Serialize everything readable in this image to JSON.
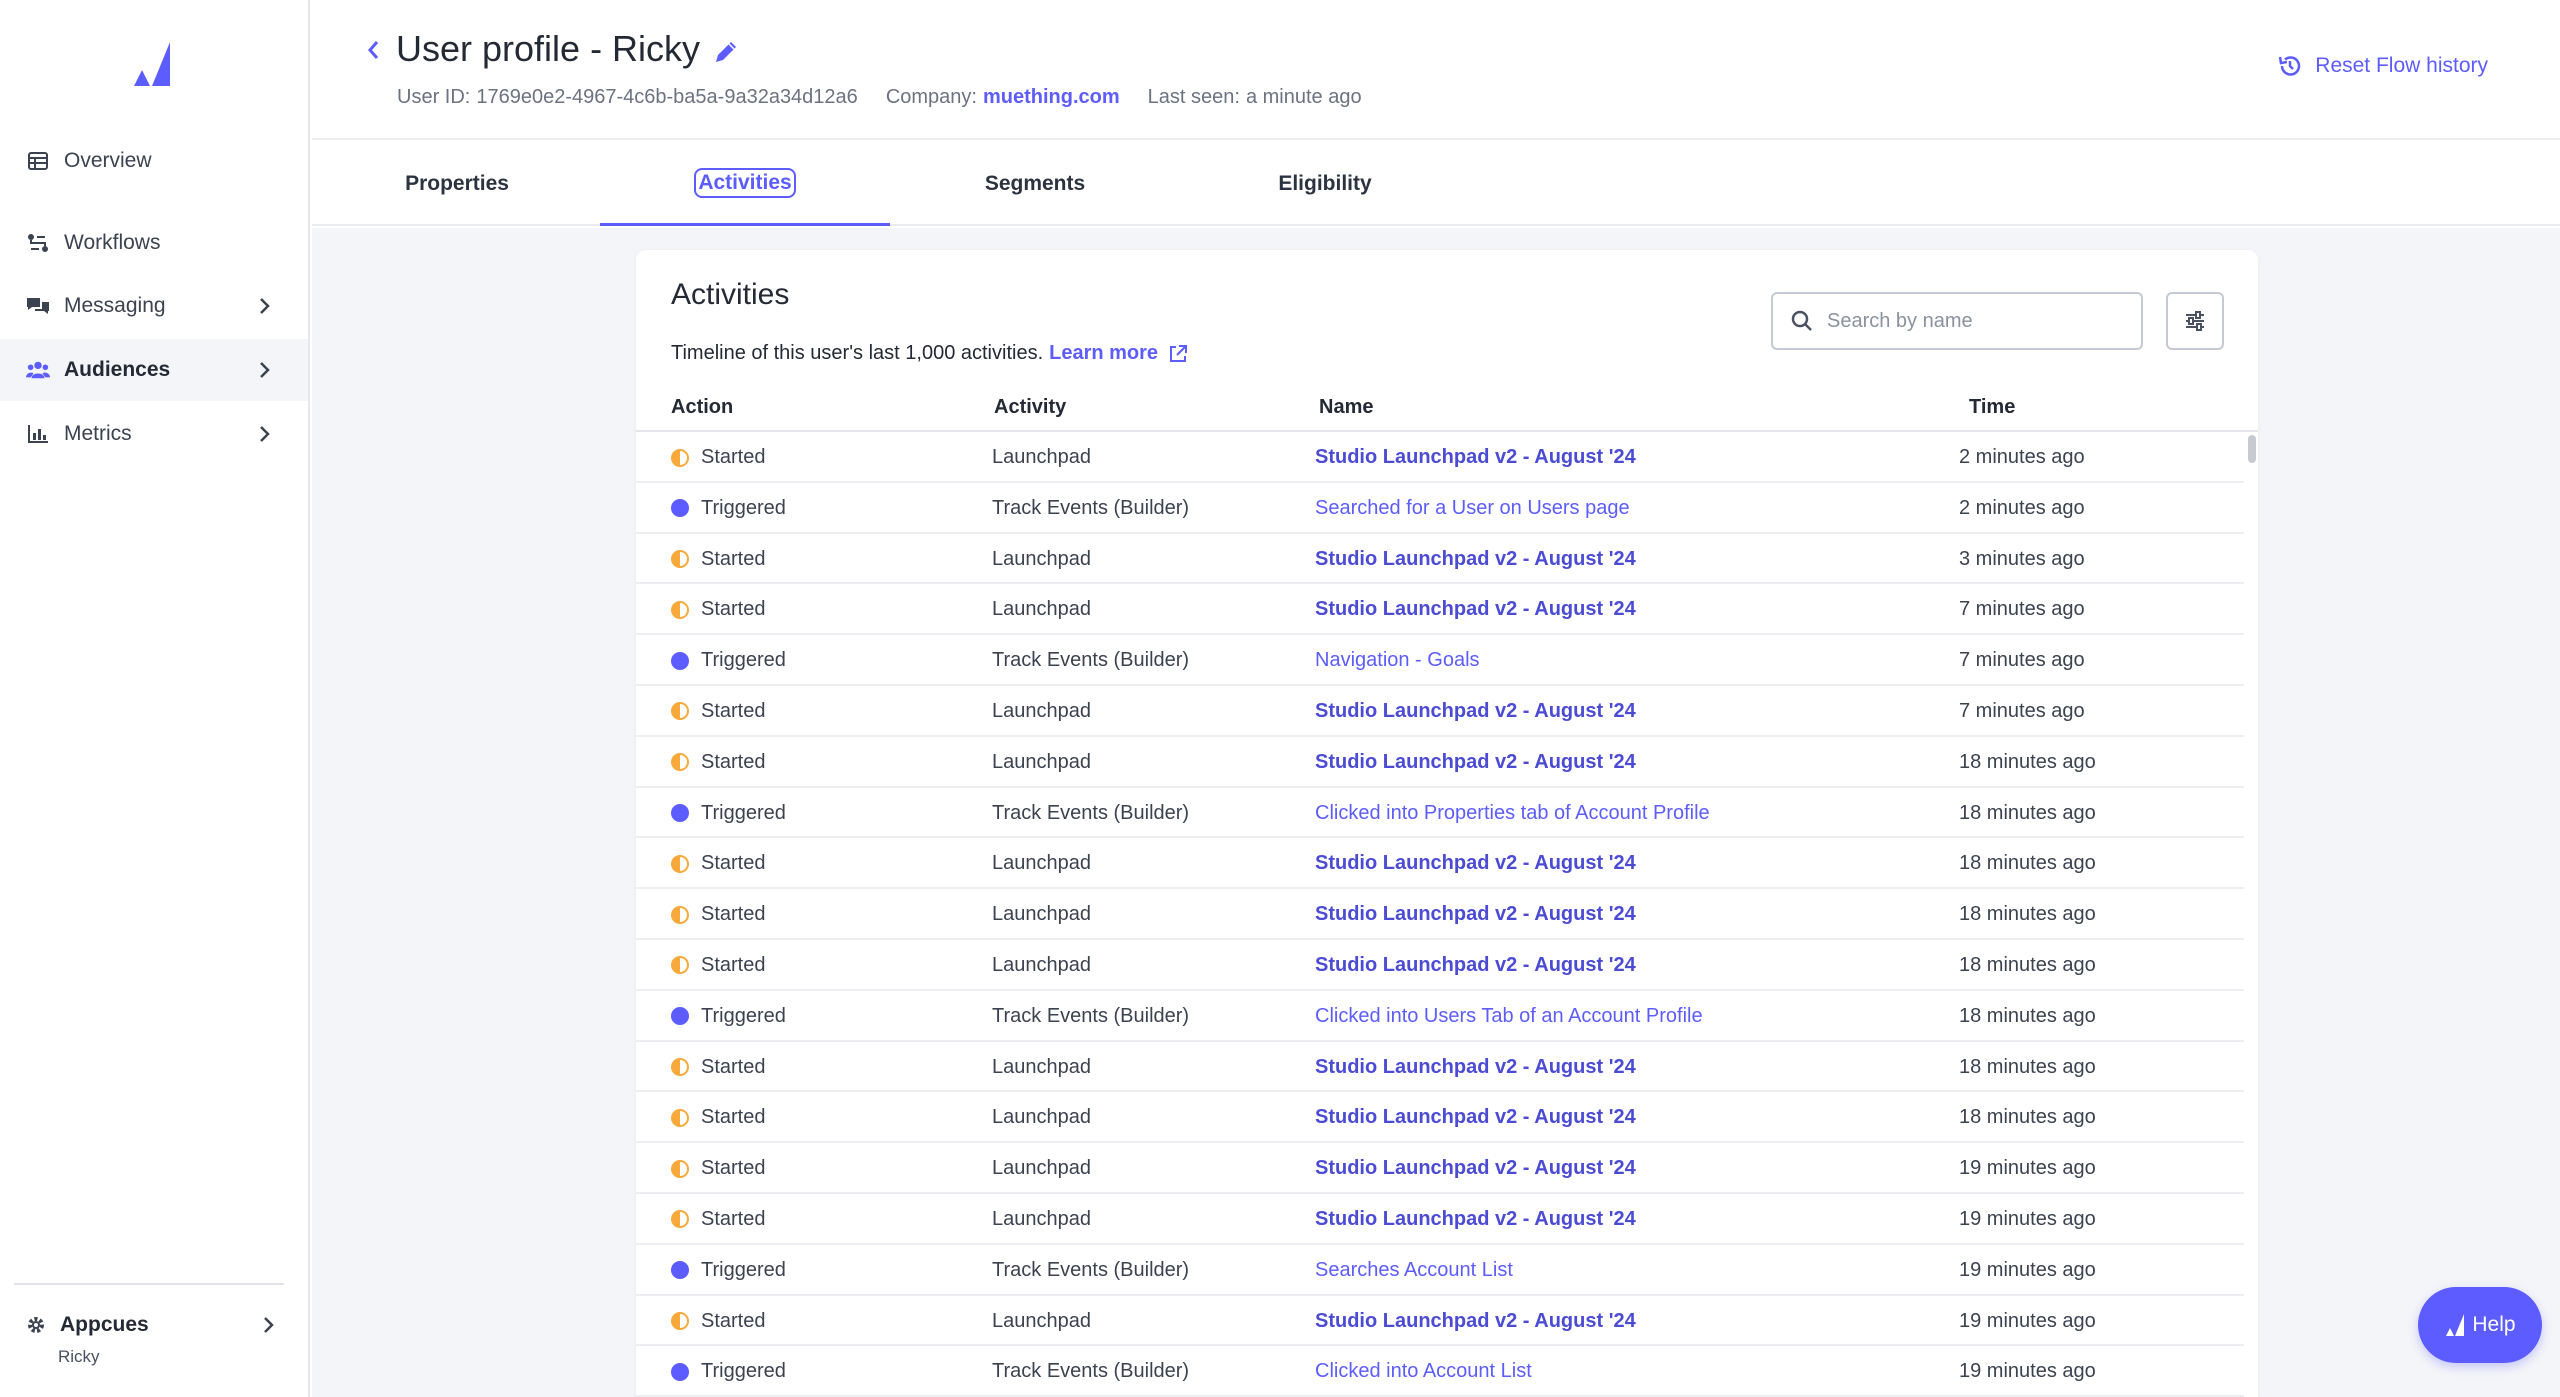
{
  "colors": {
    "accent": "#5c5cff",
    "started": "#f7a93b",
    "triggered": "#5c5cff"
  },
  "sidebar": {
    "logo_icon": "appcues-logo-icon",
    "items": [
      {
        "label": "Overview",
        "icon": "table-icon",
        "has_chevron": false,
        "active": false
      },
      {
        "label": "Workflows",
        "icon": "workflow-icon",
        "has_chevron": false,
        "active": false
      },
      {
        "label": "Messaging",
        "icon": "chat-icon",
        "has_chevron": true,
        "active": false
      },
      {
        "label": "Audiences",
        "icon": "users-icon",
        "has_chevron": true,
        "active": true
      },
      {
        "label": "Metrics",
        "icon": "bar-chart-icon",
        "has_chevron": true,
        "active": false
      }
    ],
    "account": {
      "name": "Appcues",
      "user": "Ricky",
      "icon": "gear-icon"
    }
  },
  "header": {
    "title": "User profile - Ricky",
    "user_id_label": "User ID:",
    "user_id": "1769e0e2-4967-4c6b-ba5a-9a32a34d12a6",
    "company_label": "Company:",
    "company": "muething.com",
    "last_seen_label": "Last seen:",
    "last_seen": "a minute ago",
    "reset_label": "Reset Flow history"
  },
  "tabs": [
    {
      "label": "Properties",
      "active": false
    },
    {
      "label": "Activities",
      "active": true
    },
    {
      "label": "Segments",
      "active": false
    },
    {
      "label": "Eligibility",
      "active": false
    }
  ],
  "activities": {
    "title": "Activities",
    "description": "Timeline of this user's last 1,000 activities.",
    "learn_more": "Learn more",
    "search_placeholder": "Search by name",
    "columns": {
      "action": "Action",
      "activity": "Activity",
      "name": "Name",
      "time": "Time"
    },
    "rows": [
      {
        "action": "Started",
        "activity": "Launchpad",
        "name": "Studio Launchpad v2 - August '24",
        "time": "2 minutes ago"
      },
      {
        "action": "Triggered",
        "activity": "Track Events (Builder)",
        "name": "Searched for a User on Users page",
        "time": "2 minutes ago"
      },
      {
        "action": "Started",
        "activity": "Launchpad",
        "name": "Studio Launchpad v2 - August '24",
        "time": "3 minutes ago"
      },
      {
        "action": "Started",
        "activity": "Launchpad",
        "name": "Studio Launchpad v2 - August '24",
        "time": "7 minutes ago"
      },
      {
        "action": "Triggered",
        "activity": "Track Events (Builder)",
        "name": "Navigation - Goals",
        "time": "7 minutes ago"
      },
      {
        "action": "Started",
        "activity": "Launchpad",
        "name": "Studio Launchpad v2 - August '24",
        "time": "7 minutes ago"
      },
      {
        "action": "Started",
        "activity": "Launchpad",
        "name": "Studio Launchpad v2 - August '24",
        "time": "18 minutes ago"
      },
      {
        "action": "Triggered",
        "activity": "Track Events (Builder)",
        "name": "Clicked into Properties tab of Account Profile",
        "time": "18 minutes ago"
      },
      {
        "action": "Started",
        "activity": "Launchpad",
        "name": "Studio Launchpad v2 - August '24",
        "time": "18 minutes ago"
      },
      {
        "action": "Started",
        "activity": "Launchpad",
        "name": "Studio Launchpad v2 - August '24",
        "time": "18 minutes ago"
      },
      {
        "action": "Started",
        "activity": "Launchpad",
        "name": "Studio Launchpad v2 - August '24",
        "time": "18 minutes ago"
      },
      {
        "action": "Triggered",
        "activity": "Track Events (Builder)",
        "name": "Clicked into Users Tab of an Account Profile",
        "time": "18 minutes ago"
      },
      {
        "action": "Started",
        "activity": "Launchpad",
        "name": "Studio Launchpad v2 - August '24",
        "time": "18 minutes ago"
      },
      {
        "action": "Started",
        "activity": "Launchpad",
        "name": "Studio Launchpad v2 - August '24",
        "time": "18 minutes ago"
      },
      {
        "action": "Started",
        "activity": "Launchpad",
        "name": "Studio Launchpad v2 - August '24",
        "time": "19 minutes ago"
      },
      {
        "action": "Started",
        "activity": "Launchpad",
        "name": "Studio Launchpad v2 - August '24",
        "time": "19 minutes ago"
      },
      {
        "action": "Triggered",
        "activity": "Track Events (Builder)",
        "name": "Searches Account List",
        "time": "19 minutes ago"
      },
      {
        "action": "Started",
        "activity": "Launchpad",
        "name": "Studio Launchpad v2 - August '24",
        "time": "19 minutes ago"
      },
      {
        "action": "Triggered",
        "activity": "Track Events (Builder)",
        "name": "Clicked into Account List",
        "time": "19 minutes ago"
      }
    ]
  },
  "help": {
    "label": "Help"
  }
}
